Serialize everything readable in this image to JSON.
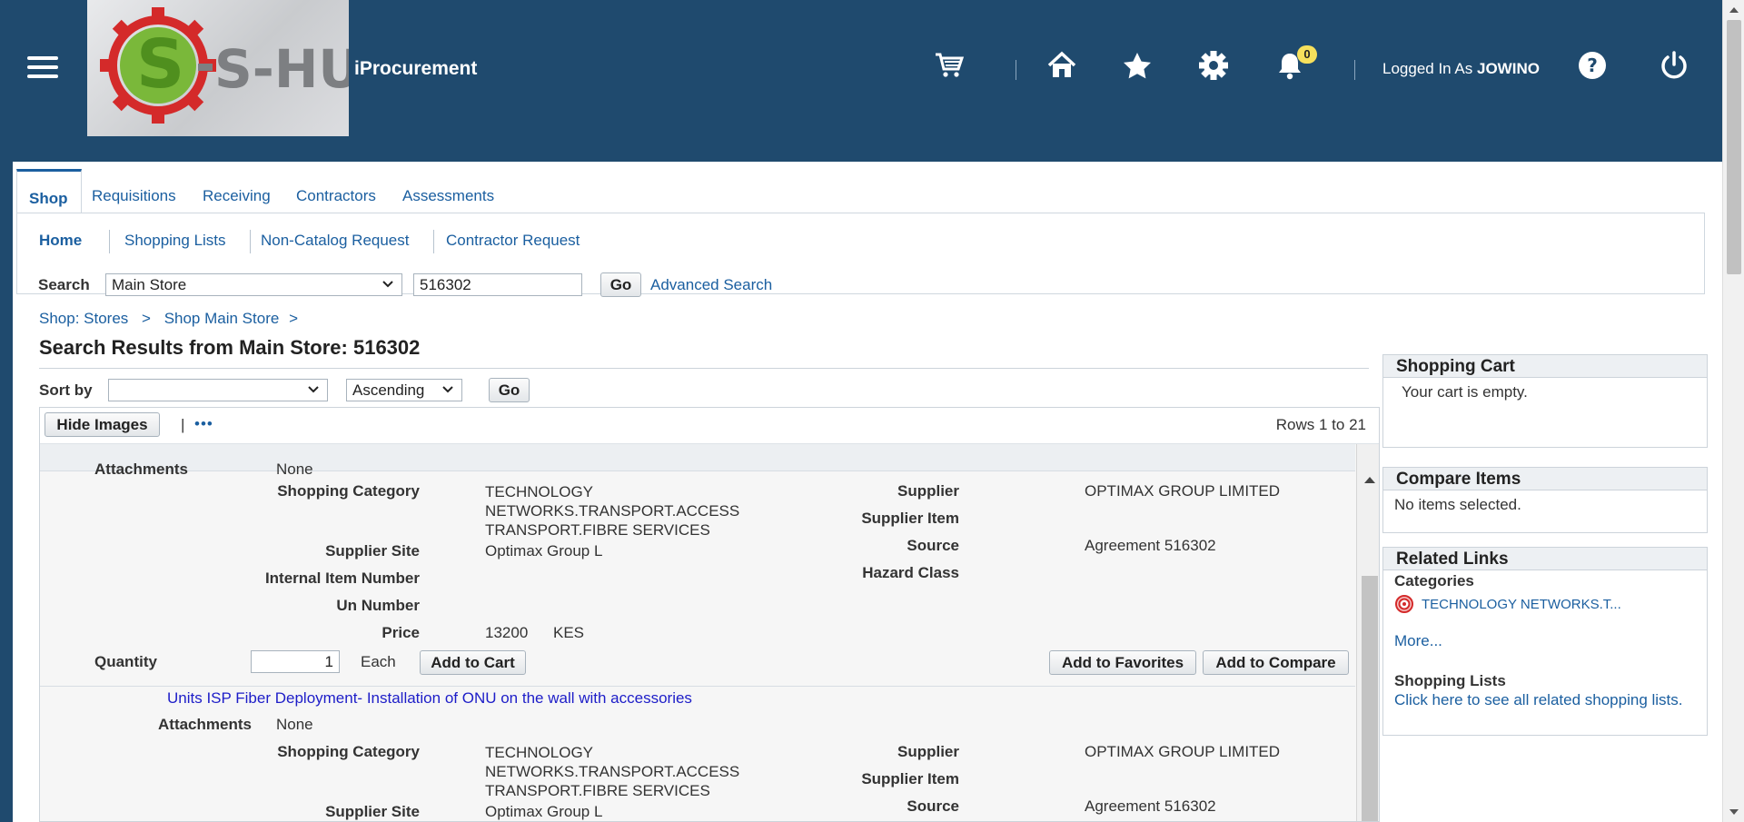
{
  "header": {
    "app_title": "iProcurement",
    "logo_text": "S-HUB",
    "logged_in_prefix": "Logged In As",
    "username": "JOWINO",
    "notification_count": "0",
    "icons": [
      "menu-icon",
      "cart-icon",
      "home-icon",
      "star-icon",
      "gear-icon",
      "bell-icon",
      "help-icon",
      "power-icon"
    ],
    "brand_color": "#1f4a6e"
  },
  "tabs": [
    {
      "label": "Shop",
      "active": true
    },
    {
      "label": "Requisitions"
    },
    {
      "label": "Receiving"
    },
    {
      "label": "Contractors"
    },
    {
      "label": "Assessments"
    }
  ],
  "subnav": [
    {
      "label": "Home",
      "active": true
    },
    {
      "label": "Shopping Lists"
    },
    {
      "label": "Non-Catalog Request"
    },
    {
      "label": "Contractor Request"
    }
  ],
  "search": {
    "label": "Search",
    "store": "Main Store",
    "value": "516302",
    "go": "Go",
    "advanced": "Advanced Search"
  },
  "breadcrumb": {
    "items": [
      "Shop: Stores",
      "Shop Main Store"
    ],
    "sep": ">"
  },
  "results": {
    "title": "Search Results from Main Store: 516302",
    "sort_label": "Sort by",
    "sort_value": "",
    "order_value": "Ascending",
    "go": "Go",
    "hide_images": "Hide Images",
    "toolbar_sep": "|",
    "more": "•••",
    "rows_info": "Rows 1 to 21"
  },
  "item1": {
    "attachments_label": "Attachments",
    "attachments_value": "None",
    "category_label": "Shopping Category",
    "category_lines": [
      "TECHNOLOGY",
      "NETWORKS.TRANSPORT.ACCESS",
      "TRANSPORT.FIBRE SERVICES"
    ],
    "supplier_site_label": "Supplier Site",
    "supplier_site": "Optimax Group L",
    "internal_item_label": "Internal Item Number",
    "un_number_label": "Un Number",
    "price_label": "Price",
    "price": "13200",
    "currency": "KES",
    "supplier_label": "Supplier",
    "supplier": "OPTIMAX GROUP LIMITED",
    "supplier_item_label": "Supplier Item",
    "source_label": "Source",
    "source": "Agreement 516302",
    "hazard_label": "Hazard Class",
    "quantity_label": "Quantity",
    "quantity": "1",
    "uom": "Each",
    "add_to_cart": "Add to Cart",
    "add_to_favorites": "Add to Favorites",
    "add_to_compare": "Add to Compare"
  },
  "item2": {
    "title": "Units ISP Fiber Deployment- Installation of ONU on the wall with accessories",
    "attachments_label": "Attachments",
    "attachments_value": "None",
    "category_label": "Shopping Category",
    "category_lines": [
      "TECHNOLOGY",
      "NETWORKS.TRANSPORT.ACCESS",
      "TRANSPORT.FIBRE SERVICES"
    ],
    "supplier_site_label": "Supplier Site",
    "supplier_site": "Optimax Group L",
    "supplier_label": "Supplier",
    "supplier": "OPTIMAX GROUP LIMITED",
    "supplier_item_label": "Supplier Item",
    "source_label": "Source",
    "source": "Agreement 516302"
  },
  "cart": {
    "title": "Shopping Cart",
    "empty": "Your cart is empty."
  },
  "compare": {
    "title": "Compare Items",
    "empty": "No items selected."
  },
  "related": {
    "title": "Related Links",
    "categories_label": "Categories",
    "category_link": "TECHNOLOGY NETWORKS.T...",
    "more": "More...",
    "shopping_lists_label": "Shopping Lists",
    "shopping_lists_link": "Click here to see all related shopping lists."
  }
}
